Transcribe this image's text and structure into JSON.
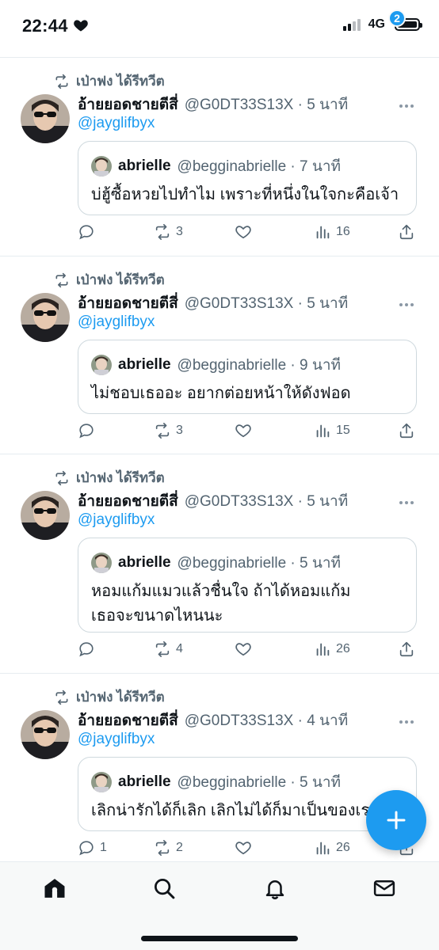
{
  "status_bar": {
    "time": "22:44",
    "heart_icon": "heart-icon",
    "network": "4G"
  },
  "tweets": [
    {
      "retweet_label": "เป่าฟง ได้รีทวีต",
      "author_name": "อ้ายยอดชายตีสี่",
      "author_handle_time": "@G0DT33S13X · 5 นาที",
      "mention": "@jayglifbyx",
      "quote": {
        "name": "abrielle",
        "handle_time": "@begginabrielle · 7 นาที",
        "text": "บ่ฮู้ซื้อหวยไปทำไม เพราะที่หนึ่งในใจกะคือเจ้า"
      },
      "actions": {
        "replies": "",
        "retweets": "3",
        "views": "16"
      }
    },
    {
      "retweet_label": "เป่าฟง ได้รีทวีต",
      "author_name": "อ้ายยอดชายตีสี่",
      "author_handle_time": "@G0DT33S13X · 5 นาที",
      "mention": "@jayglifbyx",
      "quote": {
        "name": "abrielle",
        "handle_time": "@begginabrielle · 9 นาที",
        "text": "ไม่ชอบเธออะ อยากต่อยหน้าให้ดังฟอด"
      },
      "actions": {
        "replies": "",
        "retweets": "3",
        "views": "15"
      }
    },
    {
      "retweet_label": "เป่าฟง ได้รีทวีต",
      "author_name": "อ้ายยอดชายตีสี่",
      "author_handle_time": "@G0DT33S13X · 5 นาที",
      "mention": "@jayglifbyx",
      "quote": {
        "name": "abrielle",
        "handle_time": "@begginabrielle · 5 นาที",
        "text": "หอมแก้มแมวแล้วชื่นใจ ถ้าได้หอมแก้มเธอจะขนาดไหนนะ"
      },
      "actions": {
        "replies": "",
        "retweets": "4",
        "views": "26"
      }
    },
    {
      "retweet_label": "เป่าฟง ได้รีทวีต",
      "author_name": "อ้ายยอดชายตีสี่",
      "author_handle_time": "@G0DT33S13X · 4 นาที",
      "mention": "@jayglifbyx",
      "quote": {
        "name": "abrielle",
        "handle_time": "@begginabrielle · 5 นาที",
        "text": "เลิกน่ารักได้ก็เลิก เลิกไม่ได้ก็มาเป็นของเราค่ะ"
      },
      "actions": {
        "replies": "1",
        "retweets": "2",
        "views": "26"
      }
    }
  ],
  "fab": {
    "icon": "plus-icon"
  },
  "bottom_nav": {
    "items": [
      "home-icon",
      "search-icon",
      "bell-icon",
      "mail-icon"
    ],
    "messages_badge": "2"
  },
  "colors": {
    "accent": "#1d9bf0",
    "text": "#0f1419",
    "secondary": "#536471",
    "divider": "#e6ecf0"
  }
}
